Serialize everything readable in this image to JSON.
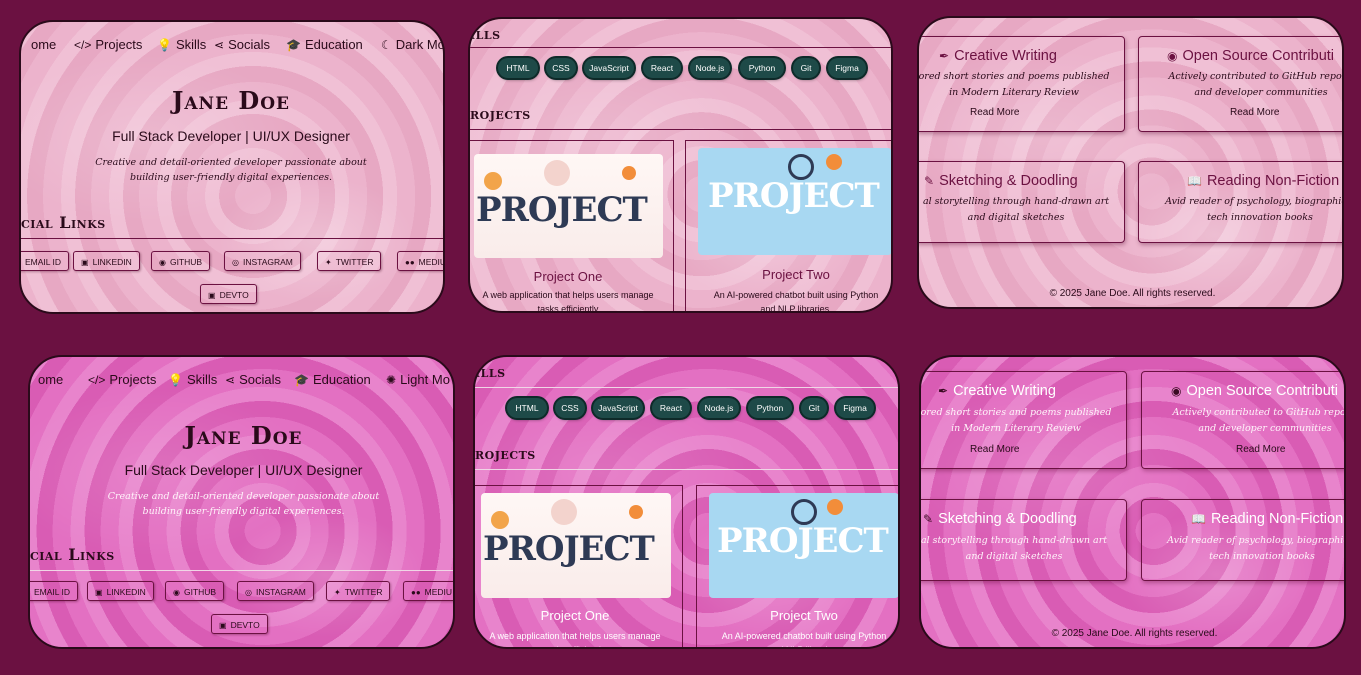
{
  "nav": {
    "home": "ome",
    "projects": "Projects",
    "skills": "Skills",
    "socials": "Socials",
    "education": "Education",
    "dark_mode": "Dark Mo",
    "light_mode": "Light Mo"
  },
  "hero": {
    "name": "Jane Doe",
    "role": "Full Stack Developer | UI/UX Designer",
    "bio_line1": "Creative and detail-oriented developer passionate about",
    "bio_line2": "building user-friendly digital experiences."
  },
  "social": {
    "heading": "cial Links",
    "buttons": [
      "EMAIL ID",
      "LINKEDIN",
      "GITHUB",
      "INSTAGRAM",
      "TWITTER",
      "MEDIU",
      "DEVTO"
    ]
  },
  "skills": {
    "heading": "ills",
    "items": [
      "HTML",
      "CSS",
      "JavaScript",
      "React",
      "Node.js",
      "Python",
      "Git",
      "Figma"
    ]
  },
  "projects": {
    "heading": "rojects",
    "img_text": "PROJECT",
    "one": {
      "title": "Project One",
      "desc1": "A web application that helps users manage",
      "desc2": "tasks efficiently"
    },
    "two": {
      "title": "Project Two",
      "desc1": "An AI-powered chatbot built using Python",
      "desc2": "and NLP libraries."
    }
  },
  "hobbies": {
    "creative": {
      "title": "Creative Writing",
      "desc1": "ored short stories and poems published",
      "desc2": "in Modern Literary Review",
      "more": "Read More"
    },
    "open_source": {
      "title": "Open Source Contributi",
      "desc1": "Actively contributed to GitHub reposit",
      "desc2": "and developer communities",
      "more": "Read More"
    },
    "sketching": {
      "title": "Sketching & Doodling",
      "desc1": "al storytelling through hand-drawn art",
      "desc2": "and digital sketches"
    },
    "reading": {
      "title": "Reading Non-Fiction",
      "desc1": "Avid reader of psychology, biographies,",
      "desc2": "tech innovation books"
    }
  },
  "footer": "© 2025 Jane Doe. All rights reserved.",
  "colors": {
    "page_bg": "#6b1141",
    "light_theme": "#ebb6cd",
    "dark_theme": "#e06fbf",
    "skill_pill": "#1e4a48",
    "accent": "#6b1141"
  }
}
